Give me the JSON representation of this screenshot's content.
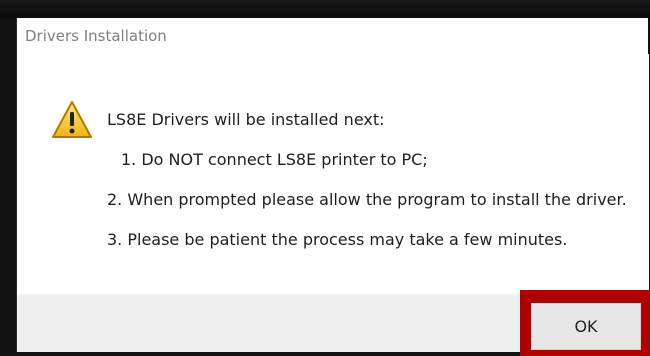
{
  "dialog": {
    "title": "Drivers Installation",
    "messages": [
      "LS8E Drivers will be installed next:",
      "1. Do NOT connect LS8E printer to PC;",
      "2. When prompted please allow the program to install the driver.",
      "3. Please be patient the process may take a few minutes."
    ],
    "ok_label": "OK",
    "icon": "warning-icon"
  },
  "colors": {
    "highlight": "#b00000",
    "warning_yellow": "#f4c430"
  }
}
